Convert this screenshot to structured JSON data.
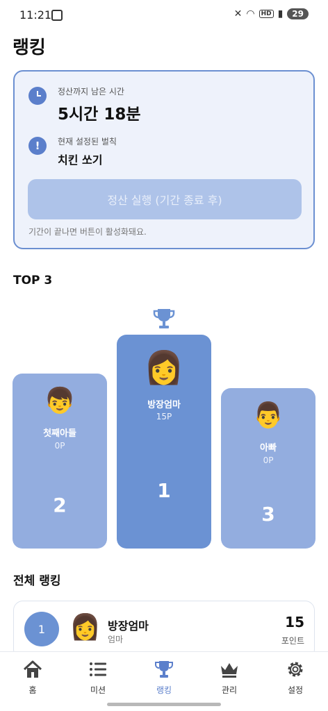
{
  "status_bar": {
    "time": "11:21",
    "battery": "29",
    "hd_label": "HD"
  },
  "page": {
    "title": "랭킹"
  },
  "settlement": {
    "time_label": "정산까지 남은 시간",
    "time_value": "5시간 18분",
    "rule_label": "현재 설정된 벌칙",
    "rule_value": "치킨 쏘기",
    "button_label": "정산 실행 (기간 종료 후)",
    "hint": "기간이 끝나면 버튼이 활성화돼요."
  },
  "top3": {
    "title": "TOP 3",
    "first": {
      "avatar": "👩",
      "name": "방장엄마",
      "points": "15P",
      "rank": "1"
    },
    "second": {
      "avatar": "👦",
      "name": "첫째아들",
      "points": "0P",
      "rank": "2"
    },
    "third": {
      "avatar": "👨",
      "name": "아빠",
      "points": "0P",
      "rank": "3"
    }
  },
  "full_ranking": {
    "title": "전체 랭킹",
    "rows": [
      {
        "rank": "1",
        "avatar": "👩",
        "name": "방장엄마",
        "role": "엄마",
        "score": "15",
        "unit": "포인트"
      }
    ]
  },
  "nav": {
    "items": [
      {
        "label": "홈",
        "icon": "home-icon"
      },
      {
        "label": "미션",
        "icon": "list-icon"
      },
      {
        "label": "랭킹",
        "icon": "trophy-icon"
      },
      {
        "label": "관리",
        "icon": "crown-icon"
      },
      {
        "label": "설정",
        "icon": "gear-icon"
      }
    ],
    "active": "랭킹"
  },
  "colors": {
    "accent": "#5b7fcb",
    "podium_first": "#6b92d3",
    "podium_other": "#93addf",
    "card_bg": "#eef2fb",
    "disabled_button": "#aec3e9"
  }
}
